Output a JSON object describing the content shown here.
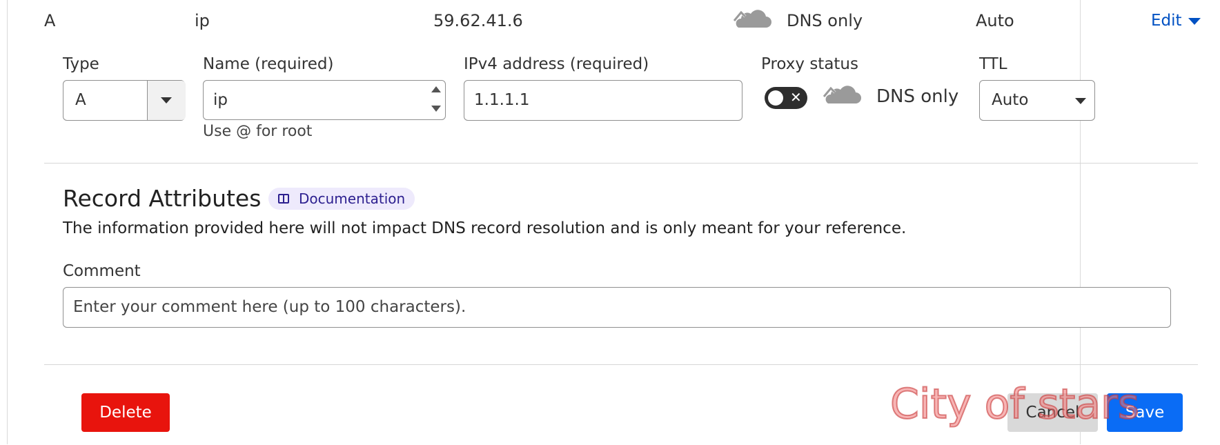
{
  "record": {
    "type": "A",
    "name": "ip",
    "content": "59.62.41.6",
    "proxy_status": "DNS only",
    "ttl": "Auto",
    "edit_label": "Edit"
  },
  "form": {
    "type_label": "Type",
    "type_value": "A",
    "name_label": "Name (required)",
    "name_value": "ip",
    "name_hint": "Use @ for root",
    "ipv4_label": "IPv4 address (required)",
    "ipv4_value": "1.1.1.1",
    "proxy_label": "Proxy status",
    "proxy_value": "DNS only",
    "ttl_label": "TTL",
    "ttl_value": "Auto"
  },
  "attributes": {
    "title": "Record Attributes",
    "doc_badge": "Documentation",
    "description": "The information provided here will not impact DNS record resolution and is only meant for your reference.",
    "comment_label": "Comment",
    "comment_placeholder": "Enter your comment here (up to 100 characters)."
  },
  "actions": {
    "delete": "Delete",
    "cancel": "Cancel",
    "save": "Save"
  },
  "watermark": "City of stars",
  "colors": {
    "link": "#0051c3",
    "danger": "#e8140d",
    "primary": "#0a6cf5",
    "cloud": "#9a9a9a",
    "badge_bg": "#eeeafc",
    "badge_text": "#2c1f8f"
  }
}
